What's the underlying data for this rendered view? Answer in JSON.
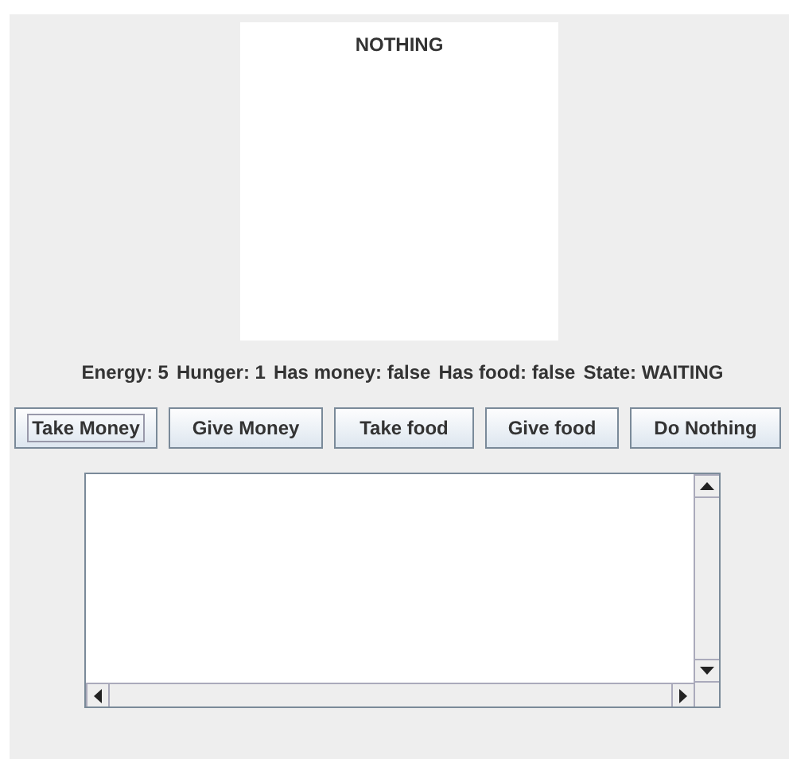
{
  "display": {
    "label": "NOTHING"
  },
  "status": [
    "Energy: 5",
    "Hunger: 1",
    "Has money: false",
    "Has food: false",
    "State: WAITING"
  ],
  "buttons": [
    {
      "label": "Take Money",
      "focused": true
    },
    {
      "label": "Give Money",
      "focused": false
    },
    {
      "label": "Take food",
      "focused": false
    },
    {
      "label": "Give food",
      "focused": false
    },
    {
      "label": "Do Nothing",
      "focused": false
    }
  ]
}
